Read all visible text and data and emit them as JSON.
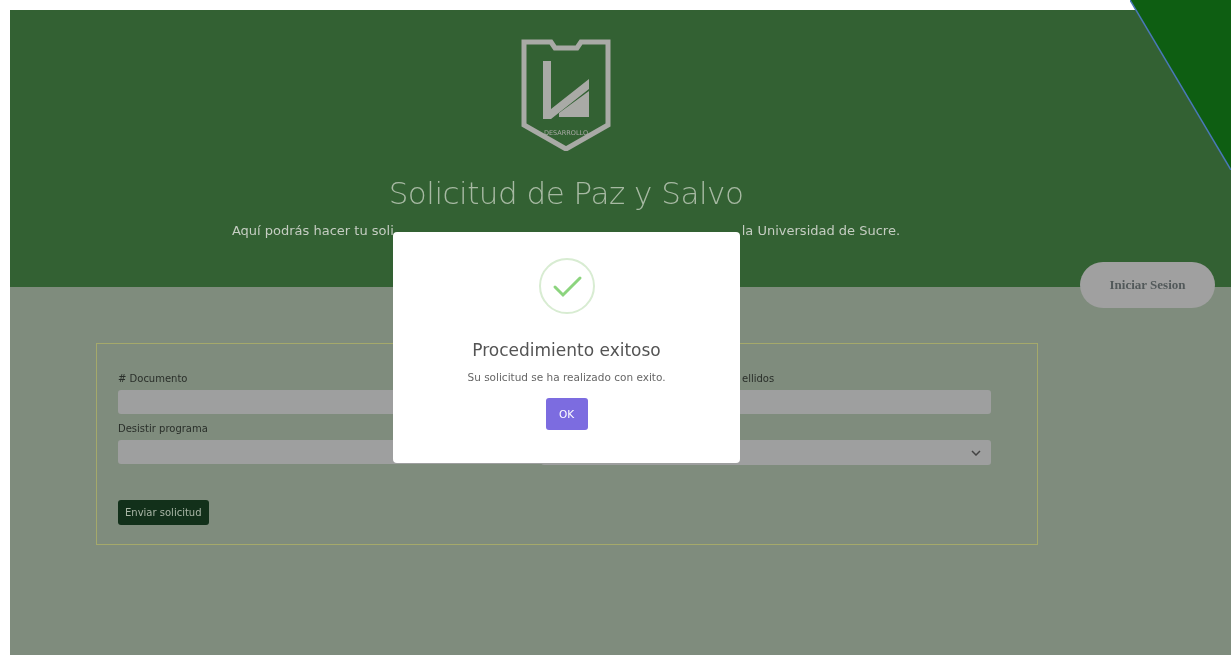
{
  "header": {
    "logo_caption": "DESARROLLO",
    "title": "Solicitud de Paz y Salvo",
    "subtitle_parts": [
      "Aquí podrás hacer tu soli",
      "la Universidad de Sucre."
    ]
  },
  "login_button": "Iniciar Sesion",
  "form": {
    "fields": [
      {
        "label": "# Documento",
        "kind": "input"
      },
      {
        "label": "ellidos",
        "kind": "input"
      },
      {
        "label": "Desistir programa",
        "kind": "input"
      },
      {
        "kind": "select"
      }
    ],
    "submit": "Enviar solicitud"
  },
  "dialog": {
    "title": "Procedimiento exitoso",
    "message": "Su solicitud se ha realizado con exito.",
    "button": "OK"
  }
}
